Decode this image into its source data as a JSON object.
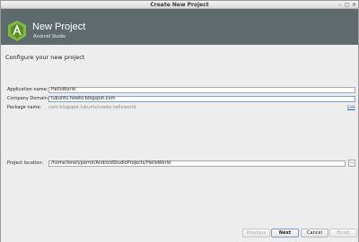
{
  "window": {
    "title": "Create New Project",
    "controls": {
      "minimize": "–",
      "maximize": "▢",
      "close": "✕"
    }
  },
  "header": {
    "title": "New Project",
    "subtitle": "Android Studio",
    "logo_icon": "android-studio-logo"
  },
  "section": {
    "title": "Configure your new project"
  },
  "form": {
    "application_name": {
      "label": "Application name:",
      "value": "HelloWorld"
    },
    "company_domain": {
      "label": "Company Domain:",
      "value": "lubuntu.howto.blogspot.com"
    },
    "package_name": {
      "label": "Package name:",
      "value": "com.blogspot.lubuntuhowto.helloworld",
      "edit_link": "Edit"
    },
    "project_location": {
      "label": "Project location:",
      "value": "/home/lonelyparrot/AndroidStudioProjects/HelloWorld",
      "browse": "..."
    }
  },
  "buttons": {
    "previous": "Previous",
    "next": "Next",
    "cancel": "Cancel",
    "finish": "Finish"
  },
  "colors": {
    "header_bg": "#5f6a6d",
    "accent": "#7a9ccf",
    "link": "#3063c4"
  }
}
